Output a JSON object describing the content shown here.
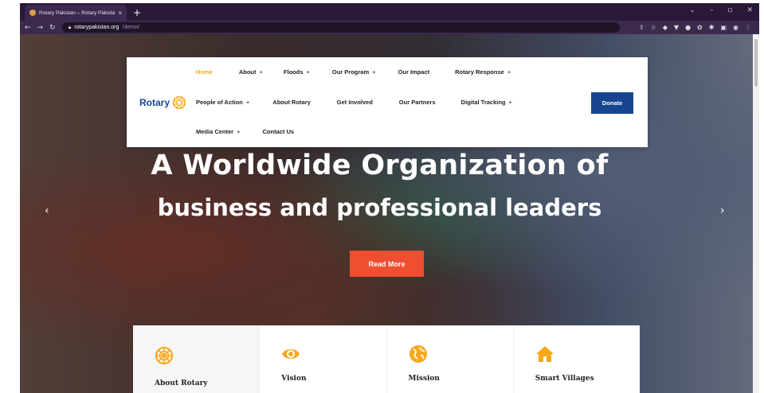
{
  "browser": {
    "tab_title": "Rotary Pakistan – Rotary Pakistan",
    "tab_close": "×",
    "new_tab": "+",
    "url_host": "rotarypakistan.org",
    "url_path": "/demo/"
  },
  "nav": {
    "logo_text": "Rotary",
    "row1": [
      {
        "label": "Home",
        "plus": ""
      },
      {
        "label": "About",
        "plus": "+"
      },
      {
        "label": "Floods",
        "plus": "+"
      },
      {
        "label": "Our Program",
        "plus": "+"
      },
      {
        "label": "Our Impact",
        "plus": ""
      },
      {
        "label": "Rotary Response",
        "plus": "+"
      }
    ],
    "row2": [
      {
        "label": "People of Action",
        "plus": "+"
      },
      {
        "label": "About Rotary",
        "plus": ""
      },
      {
        "label": "Get Involved",
        "plus": ""
      },
      {
        "label": "Our Partners",
        "plus": ""
      },
      {
        "label": "Digital Tracking",
        "plus": "+"
      }
    ],
    "row3": [
      {
        "label": "Media Center",
        "plus": "+"
      },
      {
        "label": "Contact Us",
        "plus": ""
      }
    ],
    "donate": "Donate"
  },
  "hero": {
    "line1": "A Worldwide Organization of",
    "line2": "business and professional leaders",
    "cta": "Read More",
    "prev": "‹",
    "next": "›"
  },
  "features": [
    {
      "title": "About Rotary",
      "icon": "rotary-wheel-icon"
    },
    {
      "title": "Vision",
      "icon": "eye-icon"
    },
    {
      "title": "Mission",
      "icon": "globe-icon"
    },
    {
      "title": "Smart Villages",
      "icon": "home-icon"
    }
  ],
  "colors": {
    "accent": "#f7a81b",
    "brand_blue": "#17458f",
    "cta_red": "#f04e30"
  }
}
